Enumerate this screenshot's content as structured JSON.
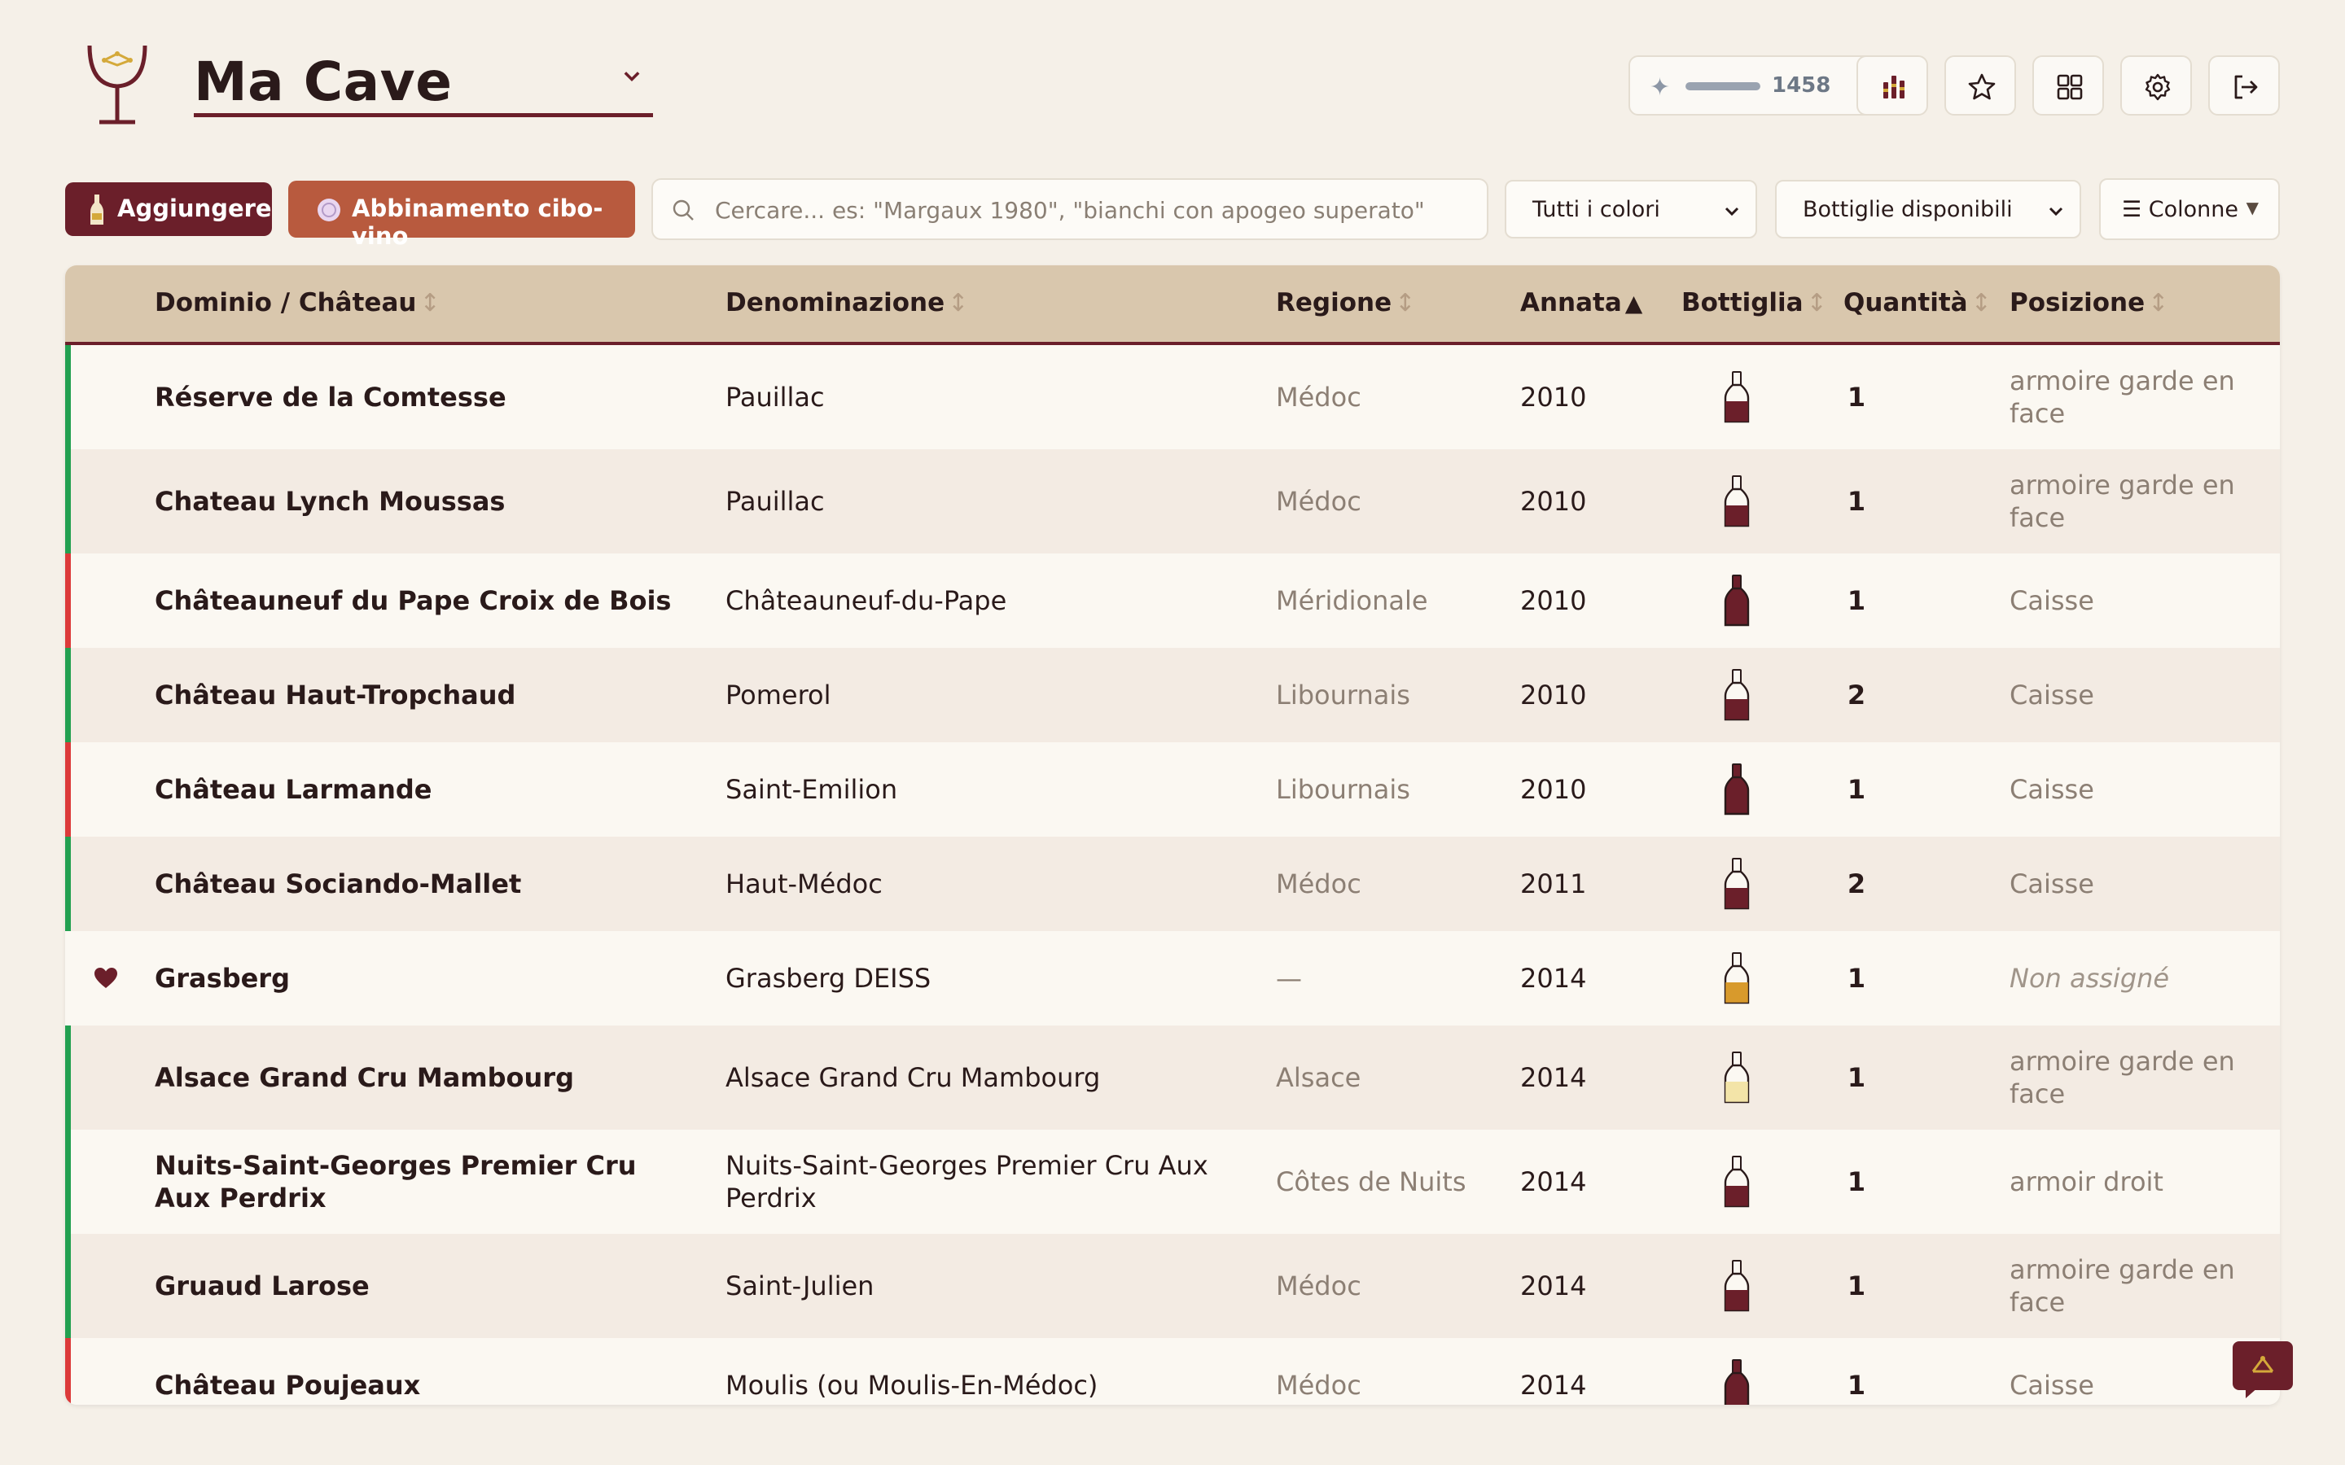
{
  "header": {
    "cellar_name": "Ma Cave",
    "xp": {
      "points": "1458",
      "progress_fraction": 1.0
    },
    "buttons": [
      "stats-icon",
      "star-icon",
      "grid-icon",
      "gear-icon",
      "logout-icon"
    ]
  },
  "toolbar": {
    "add_label": "Aggiungere",
    "pairing_label": "Abbinamento cibo-vino",
    "search_placeholder": "Cercare... es: \"Margaux 1980\", \"bianchi con apogeo superato\"",
    "color_filter": "Tutti i colori",
    "stock_filter": "Bottiglie disponibili",
    "columns_label": "☰ Colonne"
  },
  "table": {
    "columns": [
      {
        "key": "name",
        "label": "Dominio / Château",
        "sort": "↕"
      },
      {
        "key": "appellation",
        "label": "Denominazione",
        "sort": "↕"
      },
      {
        "key": "region",
        "label": "Regione",
        "sort": "↕"
      },
      {
        "key": "vintage",
        "label": "Annata",
        "sort": "▲"
      },
      {
        "key": "bottle",
        "label": "Bottiglia",
        "sort": "↕"
      },
      {
        "key": "quantity",
        "label": "Quantità",
        "sort": "↕"
      },
      {
        "key": "location",
        "label": "Posizione",
        "sort": "↕"
      }
    ],
    "rows": [
      {
        "name": "Réserve de la Comtesse",
        "appellation": "Pauillac",
        "region": "Médoc",
        "vintage": "2010",
        "quantity": "1",
        "location": "armoire garde en face",
        "status_color": "#22a050",
        "favorite": false,
        "bottle_type": "red-labeled"
      },
      {
        "name": "Chateau Lynch Moussas",
        "appellation": "Pauillac",
        "region": "Médoc",
        "vintage": "2010",
        "quantity": "1",
        "location": "armoire garde en face",
        "status_color": "#22a050",
        "favorite": false,
        "bottle_type": "red-labeled"
      },
      {
        "name": "Châteauneuf du Pape Croix de Bois",
        "appellation": "Châteauneuf-du-Pape",
        "region": "Méridionale",
        "vintage": "2010",
        "quantity": "1",
        "location": "Caisse",
        "status_color": "#dc3a3a",
        "favorite": false,
        "bottle_type": "red"
      },
      {
        "name": "Château Haut-Tropchaud",
        "appellation": "Pomerol",
        "region": "Libournais",
        "vintage": "2010",
        "quantity": "2",
        "location": "Caisse",
        "status_color": "#22a050",
        "favorite": false,
        "bottle_type": "red-labeled"
      },
      {
        "name": "Château Larmande",
        "appellation": "Saint-Emilion",
        "region": "Libournais",
        "vintage": "2010",
        "quantity": "1",
        "location": "Caisse",
        "status_color": "#dc3a3a",
        "favorite": false,
        "bottle_type": "red"
      },
      {
        "name": "Château Sociando-Mallet",
        "appellation": "Haut-Médoc",
        "region": "Médoc",
        "vintage": "2011",
        "quantity": "2",
        "location": "Caisse",
        "status_color": "#22a050",
        "favorite": false,
        "bottle_type": "red-labeled"
      },
      {
        "name": "Grasberg",
        "appellation": "Grasberg DEISS",
        "region": "—",
        "vintage": "2014",
        "quantity": "1",
        "location": "Non assigné",
        "status_color": "",
        "favorite": true,
        "bottle_type": "amber"
      },
      {
        "name": "Alsace Grand Cru Mambourg",
        "appellation": "Alsace Grand Cru Mambourg",
        "region": "Alsace",
        "vintage": "2014",
        "quantity": "1",
        "location": "armoire garde en face",
        "status_color": "#22a050",
        "favorite": false,
        "bottle_type": "white"
      },
      {
        "name": "Nuits-Saint-Georges Premier Cru Aux Perdrix",
        "appellation": "Nuits-Saint-Georges Premier Cru Aux Perdrix",
        "region": "Côtes de Nuits",
        "vintage": "2014",
        "quantity": "1",
        "location": "armoir droit",
        "status_color": "#22a050",
        "favorite": false,
        "bottle_type": "red-labeled"
      },
      {
        "name": "Gruaud Larose",
        "appellation": "Saint-Julien",
        "region": "Médoc",
        "vintage": "2014",
        "quantity": "1",
        "location": "armoire garde en face",
        "status_color": "#22a050",
        "favorite": false,
        "bottle_type": "red-labeled"
      },
      {
        "name": "Château Poujeaux",
        "appellation": "Moulis (ou Moulis-En-Médoc)",
        "region": "Médoc",
        "vintage": "2014",
        "quantity": "1",
        "location": "Caisse",
        "status_color": "#dc3a3a",
        "favorite": false,
        "bottle_type": "red"
      }
    ]
  },
  "colors": {
    "accent": "#6b1f2a",
    "pairing": "#b85a3e",
    "header_bg": "#d9c7ad",
    "ready": "#22a050",
    "past_peak": "#dc3a3a"
  }
}
